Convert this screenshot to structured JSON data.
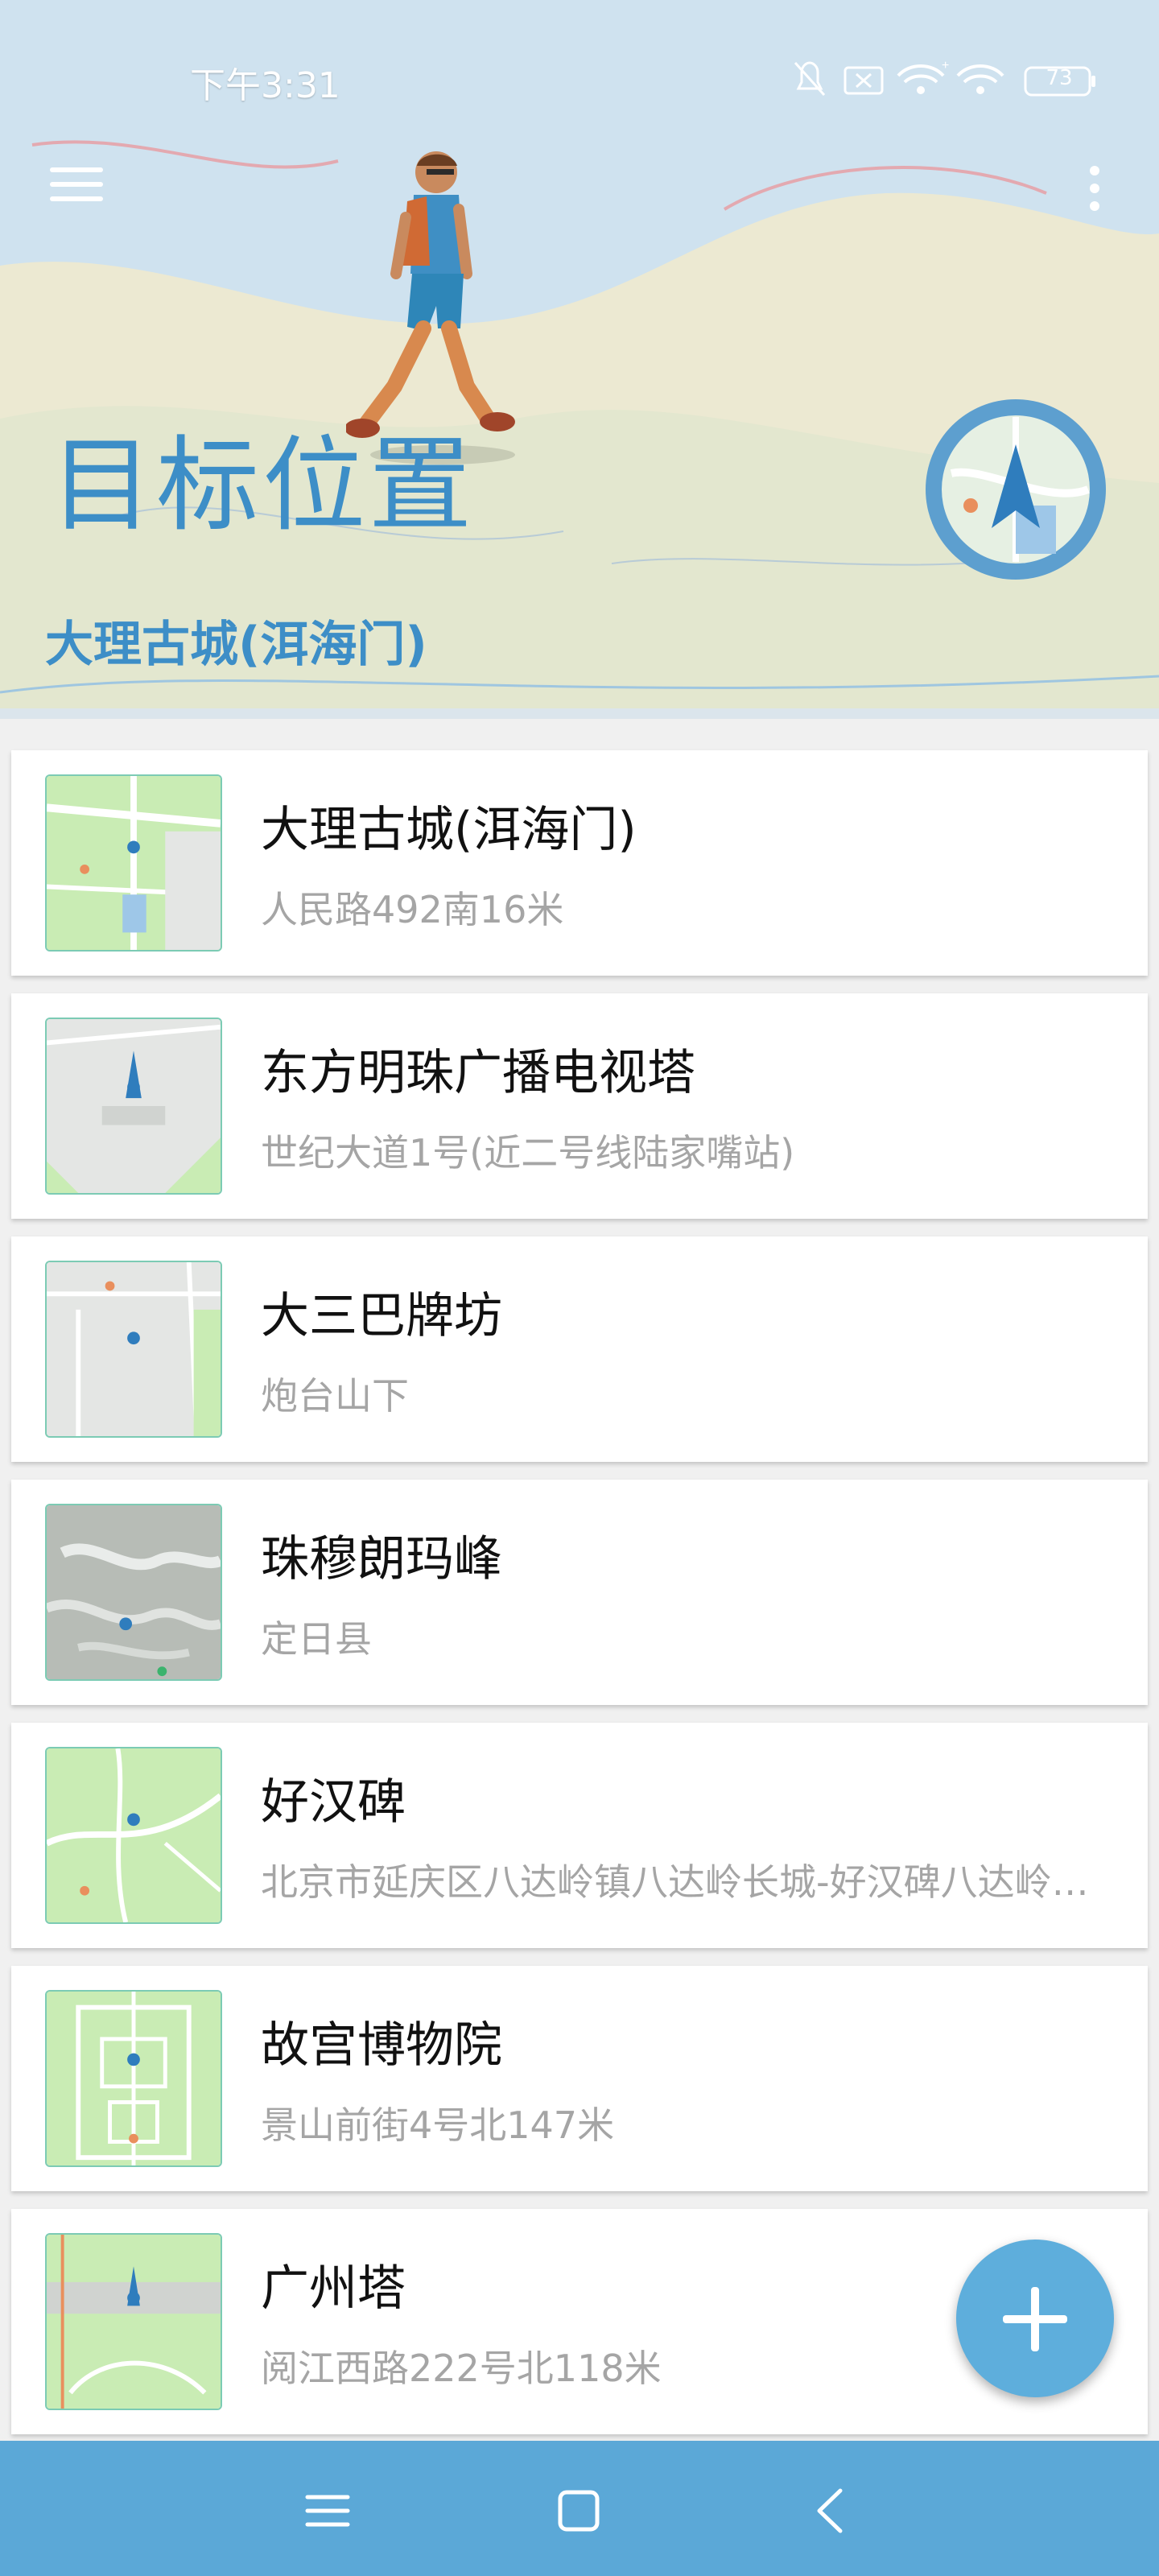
{
  "status_bar": {
    "time": "下午3:31",
    "battery": "73",
    "icons": [
      "mute-bell-icon",
      "sim-off-icon",
      "wifi-plus-icon",
      "wifi-icon",
      "battery-icon"
    ]
  },
  "header": {
    "title": "目标位置",
    "subtitle": "大理古城(洱海门)",
    "menu_icon": "hamburger-menu-icon",
    "more_icon": "more-vert-icon",
    "compass_icon": "navigation-compass-icon"
  },
  "locations": [
    {
      "name": "大理古城(洱海门)",
      "address": "人民路492南16米",
      "thumb_style": "green"
    },
    {
      "name": "东方明珠广播电视塔",
      "address": "世纪大道1号(近二号线陆家嘴站)",
      "thumb_style": "grey"
    },
    {
      "name": "大三巴牌坊",
      "address": "炮台山下",
      "thumb_style": "grey"
    },
    {
      "name": "珠穆朗玛峰",
      "address": "定日县",
      "thumb_style": "terrain"
    },
    {
      "name": "好汉碑",
      "address": "北京市延庆区八达岭镇八达岭长城-好汉碑八达岭长城好汉碑",
      "thumb_style": "green"
    },
    {
      "name": "故宫博物院",
      "address": "景山前街4号北147米",
      "thumb_style": "green"
    },
    {
      "name": "广州塔",
      "address": "阅江西路222号北118米",
      "thumb_style": "green"
    }
  ],
  "fab": {
    "icon": "add-icon"
  },
  "nav_bar": {
    "icons": [
      "recents-menu-icon",
      "home-square-icon",
      "back-chevron-icon"
    ]
  },
  "colors": {
    "accent": "#3d8ec7",
    "fab": "#5eaedc",
    "nav_bar": "#5ba8d7",
    "map_green": "#c9ecb4",
    "map_grey": "#e4e6e4"
  }
}
